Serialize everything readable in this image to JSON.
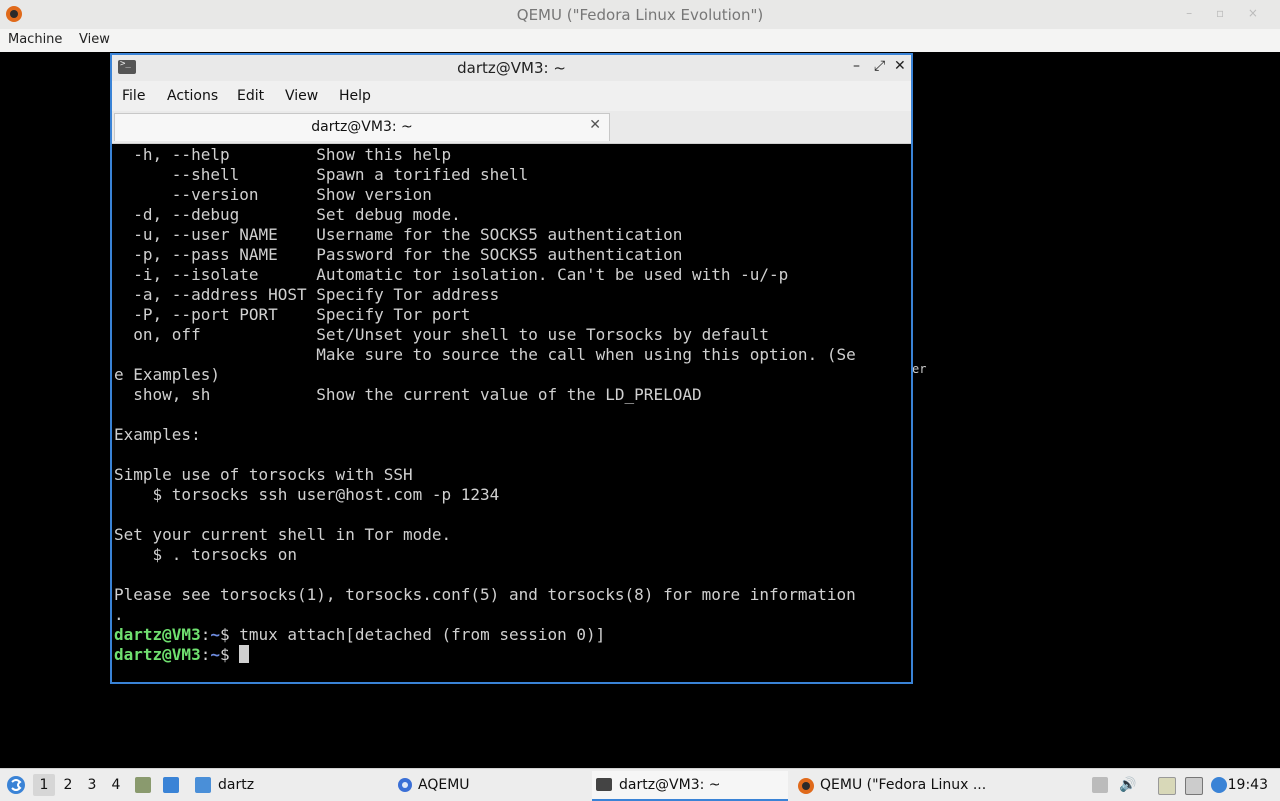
{
  "qemu": {
    "title": "QEMU (\"Fedora Linux Evolution\")",
    "menu": [
      "Machine",
      "View"
    ]
  },
  "background_leak": "er",
  "terminal": {
    "title": "dartz@VM3: ~",
    "menu": [
      "File",
      "Actions",
      "Edit",
      "View",
      "Help"
    ],
    "tab_label": "dartz@VM3: ~",
    "lines": [
      "  -h, --help         Show this help",
      "      --shell        Spawn a torified shell",
      "      --version      Show version",
      "  -d, --debug        Set debug mode.",
      "  -u, --user NAME    Username for the SOCKS5 authentication",
      "  -p, --pass NAME    Password for the SOCKS5 authentication",
      "  -i, --isolate      Automatic tor isolation. Can't be used with -u/-p",
      "  -a, --address HOST Specify Tor address",
      "  -P, --port PORT    Specify Tor port",
      "  on, off            Set/Unset your shell to use Torsocks by default",
      "                     Make sure to source the call when using this option. (Se",
      "e Examples)",
      "  show, sh           Show the current value of the LD_PRELOAD",
      "",
      "Examples:",
      "",
      "Simple use of torsocks with SSH",
      "    $ torsocks ssh user@host.com -p 1234",
      "",
      "Set your current shell in Tor mode.",
      "    $ . torsocks on",
      "",
      "Please see torsocks(1), torsocks.conf(5) and torsocks(8) for more information",
      "."
    ],
    "prompt_user": "dartz@VM3",
    "prompt_sep": ":",
    "prompt_path": "~",
    "prompt_dollar": "$ ",
    "cmd1": "tmux attach[detached (from session 0)]",
    "cmd2": ""
  },
  "taskbar": {
    "workspaces": [
      "1",
      "2",
      "3",
      "4"
    ],
    "folder_label": "dartz",
    "tasks": [
      "AQEMU",
      "dartz@VM3: ~",
      "QEMU (\"Fedora Linux ..."
    ],
    "clock": "19:43"
  },
  "colors": {
    "accent": "#3a83d6",
    "prompt_user": "#6fe06f",
    "prompt_path": "#6f8de0"
  }
}
